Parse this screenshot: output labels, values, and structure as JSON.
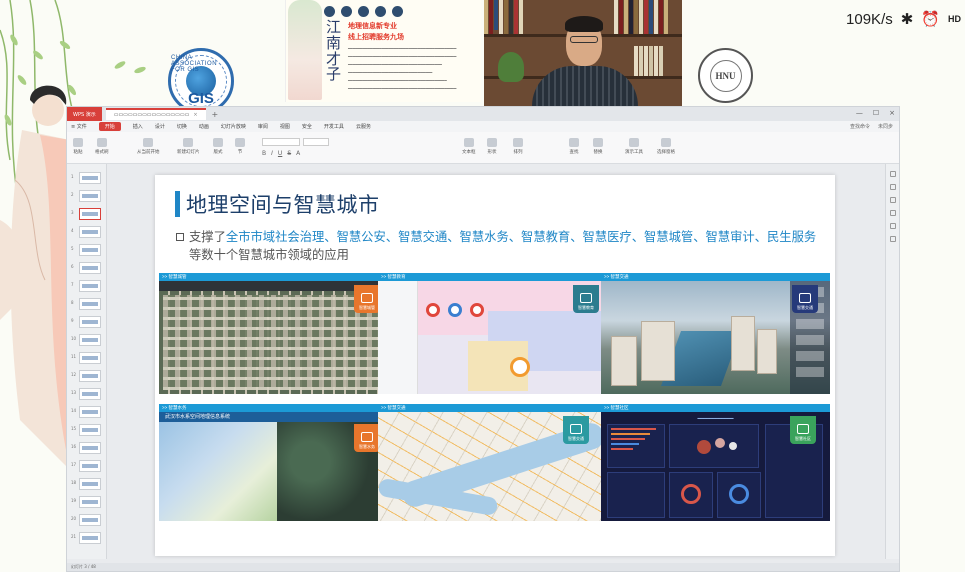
{
  "system_status": {
    "network_speed": "109K/s",
    "icons": [
      "bluetooth-icon",
      "alarm-icon",
      "hd-icon"
    ]
  },
  "banner": {
    "gis_logo_text": "GIS",
    "gis_logo_arc": "CHINA ASSOCIATION FOR GIS",
    "poster_vertical_title": "江南才子",
    "poster_line1": "地理信息新专业",
    "poster_line2": "线上招聘服务九场",
    "school_seal_text": "HNU"
  },
  "wps": {
    "app_tab": "WPS 演示",
    "menu_items": [
      "开始",
      "插入",
      "设计",
      "切换",
      "动画",
      "幻灯片放映",
      "审阅",
      "视图",
      "安全",
      "开发工具",
      "云服务"
    ],
    "menu_right": [
      "查找命令",
      "未同步"
    ],
    "ribbon_groups": [
      "粘贴",
      "格式刷",
      "从当前开始",
      "新建幻灯片",
      "版式",
      "节",
      "文本框",
      "形状",
      "排列",
      "查找",
      "替换",
      "演示工具",
      "选择窗格"
    ],
    "status_bar": "幻灯片 3 / 48"
  },
  "slide": {
    "title": "地理空间与智慧城市",
    "bullet_prefix": "支撑了",
    "bullet_highlight": "全市市域社会治理、智慧公安、智慧交通、智慧水务、智慧教育、智慧医疗、智慧城管、智慧审计、民生服务",
    "bullet_suffix": "等数十个智慧城市领域的应用",
    "panels": [
      {
        "header": ">> 智慧城管",
        "tag": "智慧城管"
      },
      {
        "header": ">> 智慧教育",
        "tag": "智慧教育"
      },
      {
        "header": ">> 智慧交通",
        "tag": "智慧交通"
      },
      {
        "header": ">> 智慧水务",
        "tag": "智慧水务"
      },
      {
        "header": ">> 智慧交通",
        "tag": "智慧交通"
      },
      {
        "header": ">> 智慧社区",
        "tag": "智慧社区"
      }
    ],
    "water_map_title": "武汉市水系空间地理信息系统"
  },
  "colors": {
    "accent_blue": "#1f86c6",
    "wps_red": "#d8403a",
    "title_navy": "#1d3f6a"
  }
}
